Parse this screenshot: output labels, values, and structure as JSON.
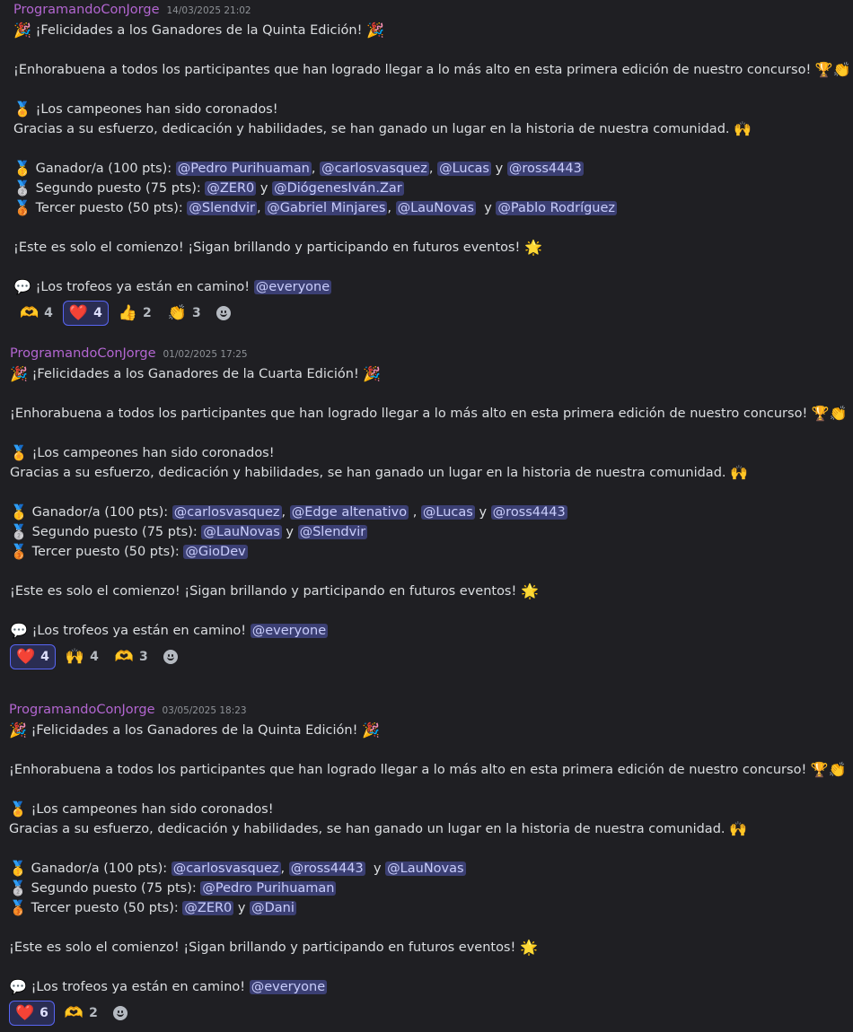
{
  "messages": [
    {
      "author": "ProgramandoConJorge",
      "timestamp": "14/03/2025 21:02",
      "title": "¡Felicidades a los Ganadores de la Quinta Edición!",
      "intro": "¡Enhorabuena a todos los participantes que han logrado llegar a lo más alto en esta primera edición de nuestro concurso!",
      "champions": "¡Los campeones han sido coronados!",
      "thanks": "Gracias a su esfuerzo, dedicación y habilidades, se han ganado un lugar en la historia de nuestra comunidad.",
      "first_label": "Ganador/a (100 pts):",
      "first_mentions": [
        "@Pedro Purihuaman",
        "@carlosvasquez",
        "@Lucas",
        "@ross4443"
      ],
      "second_label": "Segundo puesto (75 pts):",
      "second_mentions": [
        "@ZER0",
        "@DiógenesIván.Zar"
      ],
      "third_label": "Tercer puesto (50 pts):",
      "third_mentions": [
        "@Slendvir",
        "@Gabriel Minjares",
        "@LauNovas",
        "@Pablo Rodríguez"
      ],
      "outro": "¡Este es solo el comienzo! ¡Sigan brillando y participando en futuros eventos!",
      "trophies": "¡Los trofeos ya están en camino!",
      "everyone": "@everyone",
      "reactions": [
        {
          "emoji": "🫶",
          "icon": "heart-hands-icon",
          "count": "4",
          "active": false
        },
        {
          "emoji": "❤️",
          "icon": "red-heart-icon",
          "count": "4",
          "active": true
        },
        {
          "emoji": "👍",
          "icon": "thumbs-up-icon",
          "count": "2",
          "active": false
        },
        {
          "emoji": "👏",
          "icon": "clapping-hands-icon",
          "count": "3",
          "active": false
        }
      ]
    },
    {
      "author": "ProgramandoConJorge",
      "timestamp": "01/02/2025 17:25",
      "title": "¡Felicidades a los Ganadores de la Cuarta Edición!",
      "intro": "¡Enhorabuena a todos los participantes que han logrado llegar a lo más alto en esta primera edición de nuestro concurso!",
      "champions": "¡Los campeones han sido coronados!",
      "thanks": "Gracias a su esfuerzo, dedicación y habilidades, se han ganado un lugar en la historia de nuestra comunidad.",
      "first_label": "Ganador/a (100 pts):",
      "first_mentions": [
        "@carlosvasquez",
        "@Edge altenativo",
        "@Lucas",
        "@ross4443"
      ],
      "second_label": "Segundo puesto (75 pts):",
      "second_mentions": [
        "@LauNovas",
        "@Slendvir"
      ],
      "third_label": "Tercer puesto (50 pts):",
      "third_mentions": [
        "@GioDev"
      ],
      "outro": "¡Este es solo el comienzo! ¡Sigan brillando y participando en futuros eventos!",
      "trophies": "¡Los trofeos ya están en camino!",
      "everyone": "@everyone",
      "reactions": [
        {
          "emoji": "❤️",
          "icon": "red-heart-icon",
          "count": "4",
          "active": true
        },
        {
          "emoji": "🙌",
          "icon": "raising-hands-icon",
          "count": "4",
          "active": false
        },
        {
          "emoji": "🫶",
          "icon": "heart-hands-icon",
          "count": "3",
          "active": false
        }
      ]
    },
    {
      "author": "ProgramandoConJorge",
      "timestamp": "03/05/2025 18:23",
      "title": "¡Felicidades a los Ganadores de la Quinta Edición!",
      "intro": "¡Enhorabuena a todos los participantes que han logrado llegar a lo más alto en esta primera edición de nuestro concurso!",
      "champions": "¡Los campeones han sido coronados!",
      "thanks": "Gracias a su esfuerzo, dedicación y habilidades, se han ganado un lugar en la historia de nuestra comunidad.",
      "first_label": "Ganador/a (100 pts):",
      "first_mentions": [
        "@carlosvasquez",
        "@ross4443",
        "@LauNovas"
      ],
      "second_label": "Segundo puesto (75 pts):",
      "second_mentions": [
        "@Pedro Purihuaman"
      ],
      "third_label": "Tercer puesto (50 pts):",
      "third_mentions": [
        "@ZER0",
        "@Dani"
      ],
      "outro": "¡Este es solo el comienzo! ¡Sigan brillando y participando en futuros eventos!",
      "trophies": "¡Los trofeos ya están en camino!",
      "everyone": "@everyone",
      "reactions": [
        {
          "emoji": "❤️",
          "icon": "red-heart-icon",
          "count": "6",
          "active": true
        },
        {
          "emoji": "🫶",
          "icon": "heart-hands-icon",
          "count": "2",
          "active": false
        }
      ]
    }
  ],
  "glyphs": {
    "party": "🎉",
    "trophy": "🏆",
    "clap": "👏",
    "medal": "🏅",
    "raise": "🙌",
    "first": "🥇",
    "second": "🥈",
    "third": "🥉",
    "sun": "🌟",
    "speech": "💬"
  },
  "colors": {
    "background": "#1f1f23",
    "author": "#b366d1",
    "mention_bg": "#3b3f73",
    "mention_text": "#c9cdfb",
    "active_reaction_border": "#5865f2"
  }
}
